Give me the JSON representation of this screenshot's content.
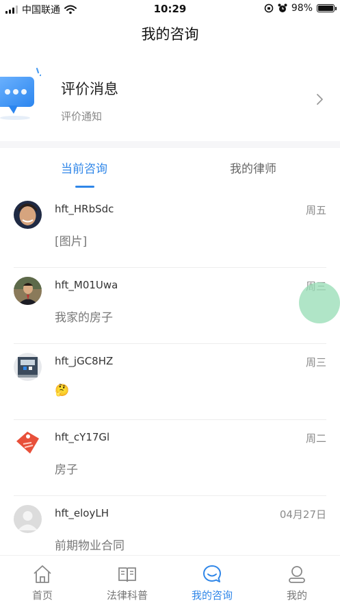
{
  "status_bar": {
    "carrier": "中国联通",
    "time": "10:29",
    "battery": "98%",
    "battery_level": 0.98
  },
  "header": {
    "title": "我的咨询"
  },
  "review": {
    "title": "评价消息",
    "subtitle": "评价通知"
  },
  "tabs": [
    {
      "label": "当前咨询",
      "active": true
    },
    {
      "label": "我的律师",
      "active": false
    }
  ],
  "conversations": [
    {
      "name": "hft_HRbSdc",
      "time": "周五",
      "message": "[图片]",
      "avatar": "photo-portrait-avatar"
    },
    {
      "name": "hft_M01Uwa",
      "time": "周三",
      "message": "我家的房子",
      "avatar": "photo-man-avatar"
    },
    {
      "name": "hft_jGC8HZ",
      "time": "周三",
      "message": "🤔",
      "avatar": "photo-building-avatar"
    },
    {
      "name": "hft_cY17Gl",
      "time": "周二",
      "message": "房子",
      "avatar": "red-tag-avatar"
    },
    {
      "name": "hft_eloyLH",
      "time": "04月27日",
      "message": "前期物业合同",
      "avatar": "default-user-avatar"
    }
  ],
  "tabbar": [
    {
      "label": "首页",
      "icon": "home-icon",
      "active": false
    },
    {
      "label": "法律科普",
      "icon": "book-icon",
      "active": false
    },
    {
      "label": "我的咨询",
      "icon": "chat-bubble-icon",
      "active": true
    },
    {
      "label": "我的",
      "icon": "user-icon",
      "active": false
    }
  ],
  "colors": {
    "accent": "#2f86e8",
    "review_icon": "#4a9cf2",
    "muted_text": "#888888"
  }
}
